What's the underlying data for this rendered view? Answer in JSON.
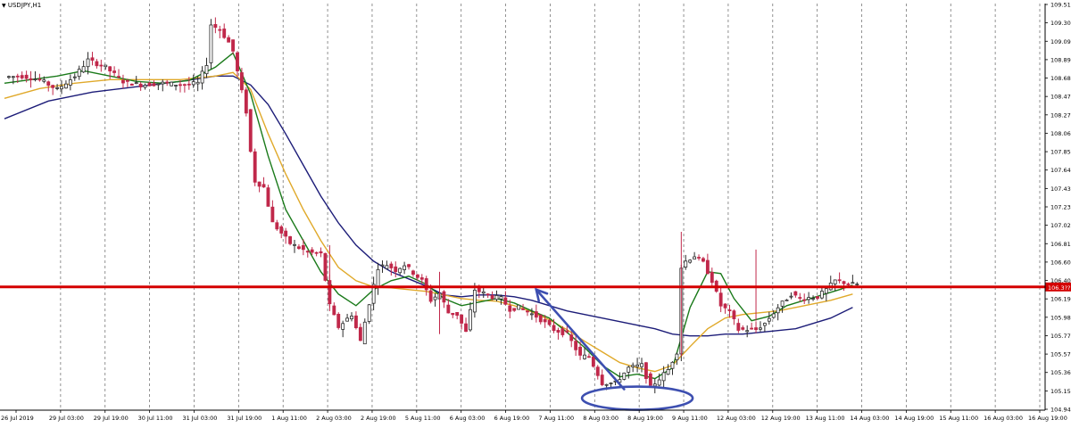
{
  "chart_data": {
    "type": "candlestick",
    "symbol_label": "USDJPY,H1",
    "current_price_label": "106.3??",
    "y_ticks": [
      "109.515",
      "109.305",
      "109.095",
      "108.890",
      "108.685",
      "108.475",
      "108.270",
      "108.060",
      "107.855",
      "107.645",
      "107.435",
      "107.230",
      "107.020",
      "106.815",
      "106.605",
      "106.400",
      "106.190",
      "105.985",
      "105.775",
      "105.570",
      "105.360",
      "105.155",
      "104.945"
    ],
    "ylim": [
      104.945,
      109.515
    ],
    "x_ticks": [
      "26 Jul 2019",
      "29 Jul 03:00",
      "29 Jul 19:00",
      "30 Jul 11:00",
      "31 Jul 03:00",
      "31 Jul 19:00",
      "1 Aug 11:00",
      "2 Aug 03:00",
      "2 Aug 19:00",
      "5 Aug 11:00",
      "6 Aug 03:00",
      "6 Aug 19:00",
      "7 Aug 11:00",
      "8 Aug 03:00",
      "8 Aug 19:00",
      "9 Aug 11:00",
      "12 Aug 03:00",
      "12 Aug 19:00",
      "13 Aug 11:00",
      "14 Aug 03:00",
      "14 Aug 19:00",
      "15 Aug 11:00",
      "16 Aug 03:00",
      "16 Aug 19:00"
    ],
    "grid": true,
    "colors": {
      "bull": "#2a2a2a",
      "bear": "#c0284a",
      "ma_fast": "#1a7a1a",
      "ma_mid": "#e0a92a",
      "ma_slow": "#1c1c78",
      "support_line": "#d40000",
      "annotation": "#3d4fb0"
    },
    "support_level": 106.33,
    "close_path": [
      [
        0,
        108.69
      ],
      [
        4,
        108.7
      ],
      [
        8,
        108.66
      ],
      [
        12,
        108.55
      ],
      [
        16,
        108.7
      ],
      [
        19,
        108.88
      ],
      [
        23,
        108.8
      ],
      [
        27,
        108.64
      ],
      [
        31,
        108.6
      ],
      [
        36,
        108.62
      ],
      [
        41,
        108.6
      ],
      [
        44,
        108.62
      ],
      [
        46,
        108.84
      ],
      [
        47,
        109.28
      ],
      [
        49,
        109.22
      ],
      [
        51,
        109.08
      ],
      [
        52,
        108.98
      ],
      [
        53,
        108.75
      ],
      [
        55,
        108.3
      ],
      [
        56,
        107.85
      ],
      [
        57,
        107.52
      ],
      [
        59,
        107.45
      ],
      [
        61,
        107.05
      ],
      [
        65,
        106.82
      ],
      [
        69,
        106.72
      ],
      [
        72,
        106.7
      ],
      [
        74,
        106.12
      ],
      [
        76,
        105.88
      ],
      [
        79,
        106.02
      ],
      [
        81,
        105.72
      ],
      [
        83,
        106.15
      ],
      [
        85,
        106.55
      ],
      [
        87,
        106.58
      ],
      [
        89,
        106.52
      ],
      [
        91,
        106.58
      ],
      [
        95,
        106.4
      ],
      [
        97,
        106.18
      ],
      [
        99,
        106.26
      ],
      [
        101,
        106.04
      ],
      [
        103,
        106.02
      ],
      [
        105,
        105.82
      ],
      [
        107,
        106.3
      ],
      [
        109,
        106.26
      ],
      [
        111,
        106.22
      ],
      [
        113,
        106.2
      ],
      [
        115,
        106.08
      ],
      [
        117,
        106.1
      ],
      [
        121,
        106.0
      ],
      [
        125,
        105.85
      ],
      [
        128,
        105.8
      ],
      [
        131,
        105.55
      ],
      [
        133,
        105.55
      ],
      [
        136,
        105.25
      ],
      [
        139,
        105.25
      ],
      [
        142,
        105.42
      ],
      [
        145,
        105.45
      ],
      [
        147,
        105.2
      ],
      [
        149,
        105.3
      ],
      [
        151,
        105.4
      ],
      [
        153,
        105.6
      ],
      [
        154,
        106.55
      ],
      [
        155,
        106.62
      ],
      [
        157,
        106.68
      ],
      [
        159,
        106.6
      ],
      [
        161,
        106.4
      ],
      [
        163,
        106.12
      ],
      [
        165,
        106.05
      ],
      [
        167,
        105.85
      ],
      [
        171,
        105.85
      ],
      [
        173,
        105.92
      ],
      [
        176,
        106.1
      ],
      [
        177,
        106.15
      ],
      [
        179,
        106.25
      ],
      [
        181,
        106.2
      ],
      [
        185,
        106.22
      ],
      [
        187,
        106.3
      ],
      [
        189,
        106.4
      ],
      [
        191,
        106.38
      ],
      [
        193,
        106.36
      ]
    ],
    "ma_fast_path": [
      [
        0,
        108.62
      ],
      [
        6,
        108.66
      ],
      [
        12,
        108.7
      ],
      [
        18,
        108.76
      ],
      [
        24,
        108.7
      ],
      [
        30,
        108.64
      ],
      [
        36,
        108.62
      ],
      [
        42,
        108.65
      ],
      [
        48,
        108.8
      ],
      [
        52,
        108.96
      ],
      [
        56,
        108.5
      ],
      [
        60,
        107.8
      ],
      [
        64,
        107.2
      ],
      [
        68,
        106.85
      ],
      [
        72,
        106.5
      ],
      [
        76,
        106.25
      ],
      [
        80,
        106.12
      ],
      [
        84,
        106.3
      ],
      [
        88,
        106.4
      ],
      [
        92,
        106.45
      ],
      [
        96,
        106.36
      ],
      [
        100,
        106.2
      ],
      [
        104,
        106.12
      ],
      [
        108,
        106.16
      ],
      [
        112,
        106.2
      ],
      [
        116,
        106.15
      ],
      [
        120,
        106.06
      ],
      [
        124,
        105.98
      ],
      [
        128,
        105.82
      ],
      [
        132,
        105.65
      ],
      [
        136,
        105.45
      ],
      [
        140,
        105.32
      ],
      [
        144,
        105.35
      ],
      [
        148,
        105.3
      ],
      [
        152,
        105.42
      ],
      [
        156,
        106.1
      ],
      [
        160,
        106.5
      ],
      [
        163,
        106.48
      ],
      [
        166,
        106.2
      ],
      [
        170,
        105.95
      ],
      [
        174,
        106.0
      ],
      [
        178,
        106.12
      ],
      [
        182,
        106.18
      ],
      [
        186,
        106.24
      ],
      [
        190,
        106.3
      ],
      [
        193,
        106.35
      ]
    ],
    "ma_mid_path": [
      [
        0,
        108.45
      ],
      [
        8,
        108.56
      ],
      [
        16,
        108.62
      ],
      [
        24,
        108.66
      ],
      [
        32,
        108.66
      ],
      [
        40,
        108.66
      ],
      [
        48,
        108.7
      ],
      [
        52,
        108.74
      ],
      [
        56,
        108.55
      ],
      [
        60,
        108.05
      ],
      [
        64,
        107.6
      ],
      [
        68,
        107.2
      ],
      [
        72,
        106.85
      ],
      [
        76,
        106.55
      ],
      [
        80,
        106.4
      ],
      [
        84,
        106.33
      ],
      [
        88,
        106.32
      ],
      [
        92,
        106.3
      ],
      [
        96,
        106.28
      ],
      [
        100,
        106.24
      ],
      [
        104,
        106.2
      ],
      [
        108,
        106.18
      ],
      [
        112,
        106.17
      ],
      [
        116,
        106.12
      ],
      [
        120,
        106.05
      ],
      [
        124,
        105.96
      ],
      [
        128,
        105.85
      ],
      [
        132,
        105.72
      ],
      [
        136,
        105.6
      ],
      [
        140,
        105.48
      ],
      [
        144,
        105.42
      ],
      [
        148,
        105.38
      ],
      [
        152,
        105.45
      ],
      [
        156,
        105.66
      ],
      [
        160,
        105.86
      ],
      [
        164,
        105.98
      ],
      [
        168,
        106.02
      ],
      [
        172,
        106.04
      ],
      [
        176,
        106.06
      ],
      [
        180,
        106.1
      ],
      [
        184,
        106.14
      ],
      [
        188,
        106.18
      ],
      [
        193,
        106.25
      ]
    ],
    "ma_slow_path": [
      [
        0,
        108.22
      ],
      [
        10,
        108.42
      ],
      [
        20,
        108.52
      ],
      [
        30,
        108.58
      ],
      [
        40,
        108.64
      ],
      [
        48,
        108.7
      ],
      [
        52,
        108.7
      ],
      [
        56,
        108.6
      ],
      [
        60,
        108.38
      ],
      [
        64,
        108.05
      ],
      [
        68,
        107.7
      ],
      [
        72,
        107.35
      ],
      [
        76,
        107.05
      ],
      [
        80,
        106.8
      ],
      [
        84,
        106.62
      ],
      [
        88,
        106.5
      ],
      [
        92,
        106.42
      ],
      [
        96,
        106.34
      ],
      [
        100,
        106.24
      ],
      [
        104,
        106.22
      ],
      [
        108,
        106.24
      ],
      [
        112,
        106.24
      ],
      [
        116,
        106.22
      ],
      [
        120,
        106.18
      ],
      [
        124,
        106.12
      ],
      [
        128,
        106.06
      ],
      [
        132,
        106.02
      ],
      [
        136,
        105.98
      ],
      [
        140,
        105.94
      ],
      [
        144,
        105.9
      ],
      [
        148,
        105.86
      ],
      [
        152,
        105.8
      ],
      [
        156,
        105.78
      ],
      [
        160,
        105.78
      ],
      [
        164,
        105.8
      ],
      [
        168,
        105.8
      ],
      [
        172,
        105.82
      ],
      [
        176,
        105.84
      ],
      [
        180,
        105.86
      ],
      [
        184,
        105.92
      ],
      [
        188,
        105.98
      ],
      [
        193,
        106.1
      ]
    ]
  }
}
